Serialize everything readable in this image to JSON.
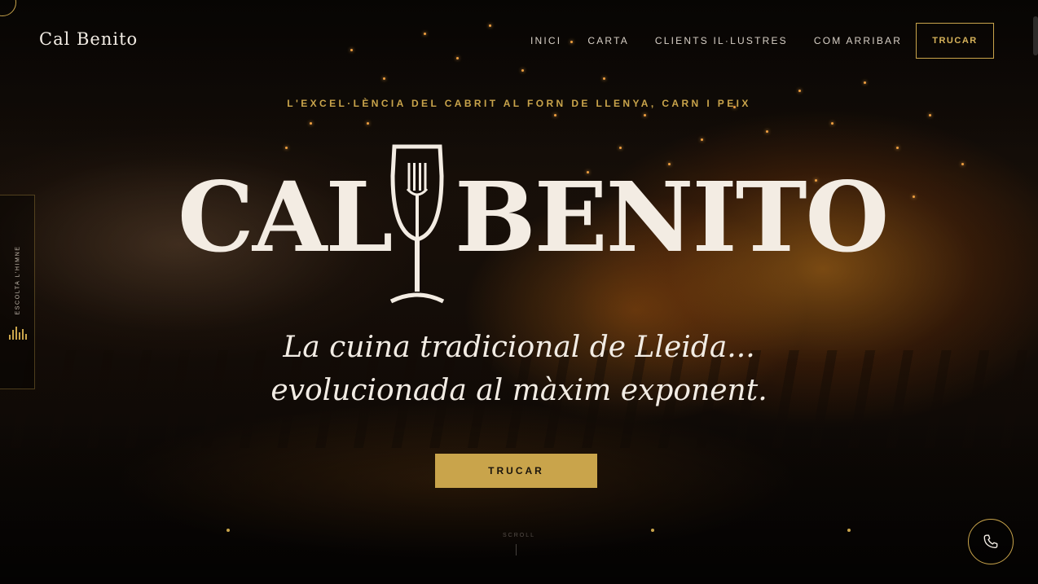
{
  "header": {
    "brand": "Cal Benito",
    "nav": [
      "INICI",
      "CARTA",
      "CLIENTS IL·LUSTRES",
      "COM ARRIBAR"
    ],
    "call_label": "TRUCAR"
  },
  "hero": {
    "tagline": "L'EXCEL·LÈNCIA DEL CABRIT AL FORN DE LLENYA, CARN I PEIX",
    "logo_left": "CAL",
    "logo_right": "BENITO",
    "subtitle_line1": "La cuina tradicional de Lleida...",
    "subtitle_line2": "evolucionada al màxim exponent.",
    "cta_label": "TRUCAR",
    "scroll_label": "SCROLL"
  },
  "side_player": {
    "label": "ESCOLTA L'HIMNE",
    "icon": "equalizer-icon"
  },
  "fab": {
    "icon": "phone-icon"
  },
  "colors": {
    "gold": "#c9a44b",
    "cream": "#f2ece4",
    "background": "#0b0806"
  }
}
